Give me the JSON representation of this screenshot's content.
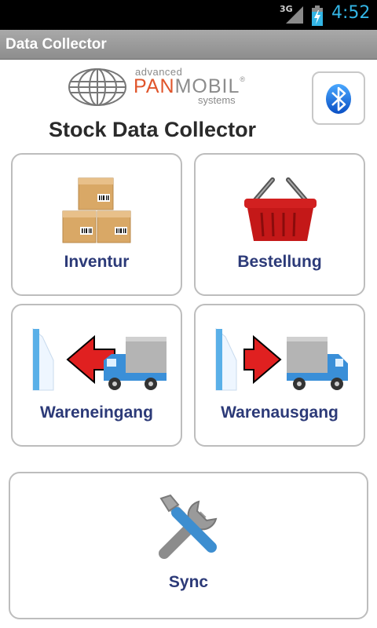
{
  "status_bar": {
    "network": "3G",
    "time": "4:52"
  },
  "app_title": "Data Collector",
  "logo": {
    "line1": "advanced",
    "brand_pan": "PAN",
    "brand_mobil": "MOBIL",
    "registered": "®",
    "line3": "systems"
  },
  "heading": "Stock Data Collector",
  "tiles": {
    "inventur": "Inventur",
    "bestellung": "Bestellung",
    "wareneingang": "Wareneingang",
    "warenausgang": "Warenausgang",
    "sync": "Sync"
  },
  "colors": {
    "label": "#2c3a78",
    "clock": "#33b5e5",
    "arrow": "#e02020",
    "truck": "#3a8fd8",
    "basket": "#c41818",
    "box": "#d9a866"
  }
}
